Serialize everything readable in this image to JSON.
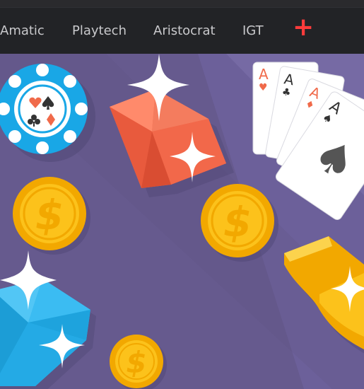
{
  "nav": {
    "items": [
      {
        "label": "Amatic"
      },
      {
        "label": "Playtech"
      },
      {
        "label": "Aristocrat"
      },
      {
        "label": "IGT"
      }
    ],
    "more_symbol": "+"
  },
  "hero": {
    "background_color": "#665a8e",
    "icons": [
      "casino-chip-icon",
      "coin-icon",
      "gem-icon",
      "sparkle-icon",
      "playing-cards-icon",
      "horseshoe-icon"
    ],
    "cards": {
      "rank": "A",
      "suits": [
        "heart",
        "club",
        "diamond",
        "spade"
      ]
    },
    "coin_symbol": "$"
  },
  "colors": {
    "navbar": "#222326",
    "accent_plus": "#ff3b3b",
    "chip": "#19a7e6",
    "coin": "#fcc21b",
    "red_gem": "#f06a4a",
    "blue_gem": "#2cb5ef"
  }
}
